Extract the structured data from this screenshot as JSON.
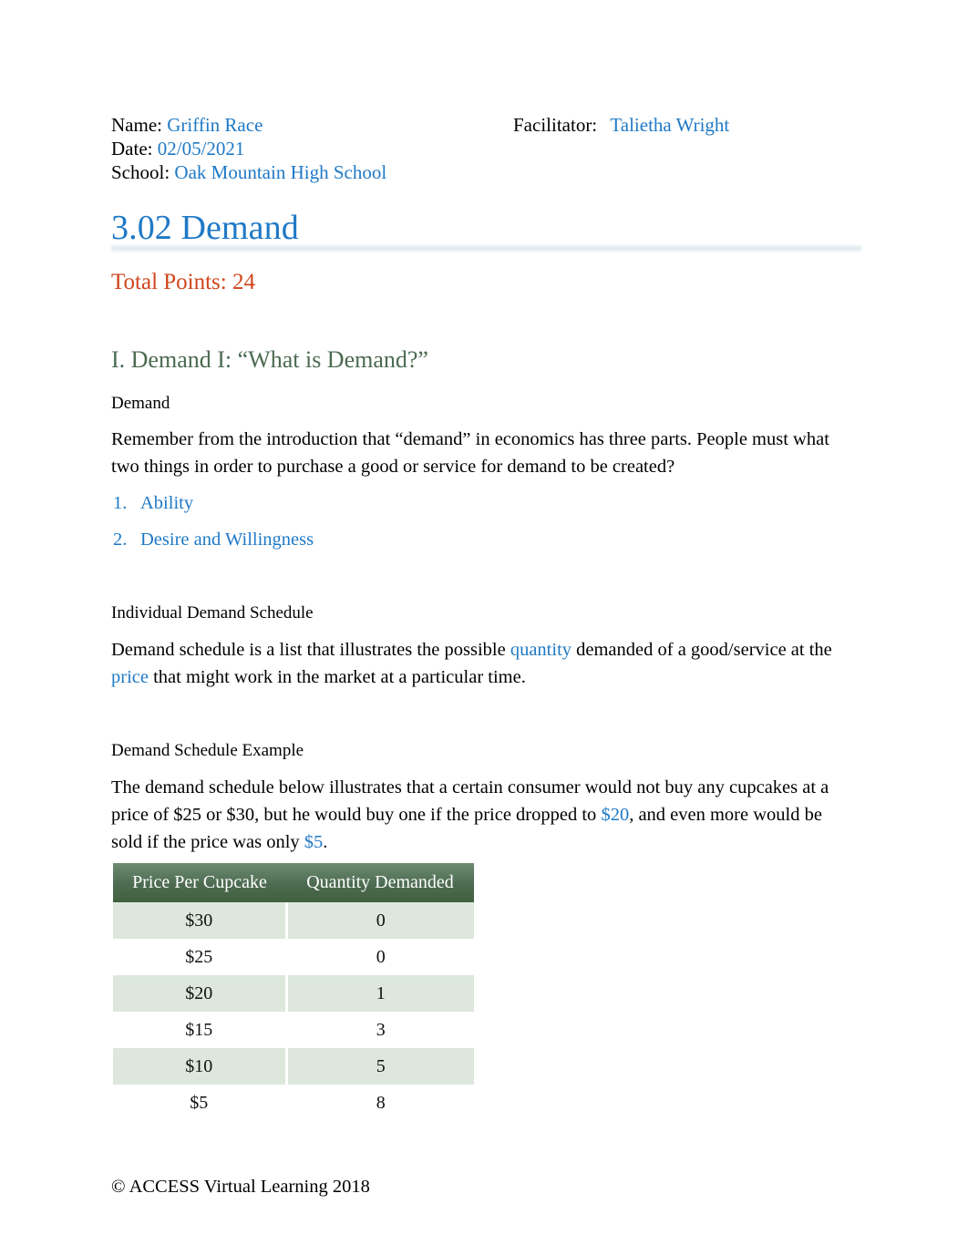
{
  "header": {
    "name_label": "Name:",
    "name_value": "Griffin Race",
    "date_label": "Date:",
    "date_value": "02/05/2021",
    "school_label": "School:",
    "school_value": "Oak Mountain High School",
    "facilitator_label": "Facilitator:",
    "facilitator_value": "Talietha Wright"
  },
  "title": "3.02 Demand",
  "total_points": "Total Points: 24",
  "section": {
    "heading": "I. Demand I: “What is Demand?”",
    "subhead_demand": "Demand",
    "question_part1": "Remember from the introduction that “demand” in economics has three parts. People must what two things in order to purchase a good or service for demand to be created?",
    "answers": [
      {
        "num": "1.",
        "text": "Ability"
      },
      {
        "num": "2.",
        "text": "Desire and Willingness"
      }
    ],
    "subhead_individual": "Individual Demand Schedule",
    "schedule_def_a": "Demand schedule is a list that illustrates the possible ",
    "schedule_def_fill1": "quantity",
    "schedule_def_b": " demanded of a good/service at the ",
    "schedule_def_fill2": "price",
    "schedule_def_c": " that might work in the market at a particular time.",
    "subhead_example": "Demand Schedule Example",
    "example_a": "The demand schedule below illustrates that a certain consumer would not buy any cupcakes at a price of $25 or $30, but he would buy one if the price dropped to ",
    "example_fill1": "$20",
    "example_b": ", and even more would be sold if the price was only ",
    "example_fill2": "$5",
    "example_c": "."
  },
  "schedule_table": {
    "columns": [
      "Price Per Cupcake",
      "Quantity Demanded"
    ],
    "rows": [
      [
        "$30",
        "0"
      ],
      [
        "$25",
        "0"
      ],
      [
        "$20",
        "1"
      ],
      [
        "$15",
        "3"
      ],
      [
        "$10",
        "5"
      ],
      [
        "$5",
        "8"
      ]
    ]
  },
  "footer": "© ACCESS Virtual Learning 2018",
  "colors": {
    "answer_blue": "#1F79C6",
    "title_blue": "#1F79C6",
    "points_red": "#D0451B",
    "heading_green": "#4C6B51",
    "table_header_green": "#4C6B51",
    "table_stripe_green": "#DDE7DC"
  }
}
